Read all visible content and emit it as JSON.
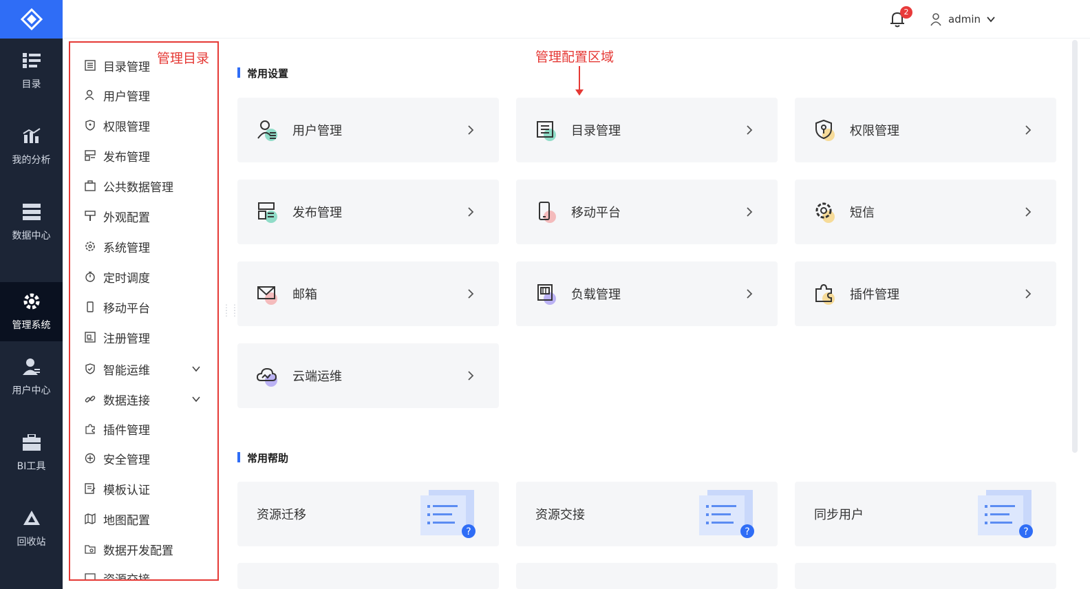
{
  "topbar": {
    "notification_count": "2",
    "username": "admin"
  },
  "nav": {
    "items": [
      {
        "label": "目录",
        "icon": "catalog-icon"
      },
      {
        "label": "我的分析",
        "icon": "analysis-icon"
      },
      {
        "label": "数据中心",
        "icon": "data-center-icon"
      },
      {
        "label": "管理系统",
        "icon": "management-gear-icon"
      },
      {
        "label": "用户中心",
        "icon": "user-center-icon"
      },
      {
        "label": "BI工具",
        "icon": "toolbox-icon"
      },
      {
        "label": "回收站",
        "icon": "recycle-icon"
      }
    ],
    "active": "管理系统"
  },
  "catalog": {
    "annotation": "管理目录",
    "items": [
      {
        "label": "目录管理"
      },
      {
        "label": "用户管理"
      },
      {
        "label": "权限管理"
      },
      {
        "label": "发布管理"
      },
      {
        "label": "公共数据管理"
      },
      {
        "label": "外观配置"
      },
      {
        "label": "系统管理"
      },
      {
        "label": "定时调度"
      },
      {
        "label": "移动平台"
      },
      {
        "label": "注册管理"
      },
      {
        "label": "智能运维"
      },
      {
        "label": "数据连接"
      },
      {
        "label": "插件管理"
      },
      {
        "label": "安全管理"
      },
      {
        "label": "模板认证"
      },
      {
        "label": "地图配置"
      },
      {
        "label": "数据开发配置"
      },
      {
        "label": "资源交接"
      }
    ]
  },
  "main": {
    "annotation": "管理配置区域",
    "common_settings_title": "常用设置",
    "settings": [
      {
        "label": "用户管理",
        "icon": "user-manage-icon",
        "color": "#3cc7a0"
      },
      {
        "label": "目录管理",
        "icon": "list-icon",
        "color": "#3cc7a0"
      },
      {
        "label": "权限管理",
        "icon": "shield-icon",
        "color": "#f5c54a"
      },
      {
        "label": "发布管理",
        "icon": "publish-icon",
        "color": "#3cc7a0"
      },
      {
        "label": "移动平台",
        "icon": "mobile-icon",
        "color": "#f28a8a"
      },
      {
        "label": "短信",
        "icon": "gear-icon",
        "color": "#f5c54a"
      },
      {
        "label": "邮箱",
        "icon": "mail-icon",
        "color": "#f28a8a"
      },
      {
        "label": "负载管理",
        "icon": "load-icon",
        "color": "#8a7af0"
      },
      {
        "label": "插件管理",
        "icon": "plugin-icon",
        "color": "#f5c54a"
      },
      {
        "label": "云端运维",
        "icon": "cloud-icon",
        "color": "#8a7af0"
      }
    ],
    "common_help_title": "常用帮助",
    "help": [
      {
        "label": "资源迁移"
      },
      {
        "label": "资源交接"
      },
      {
        "label": "同步用户"
      }
    ]
  }
}
